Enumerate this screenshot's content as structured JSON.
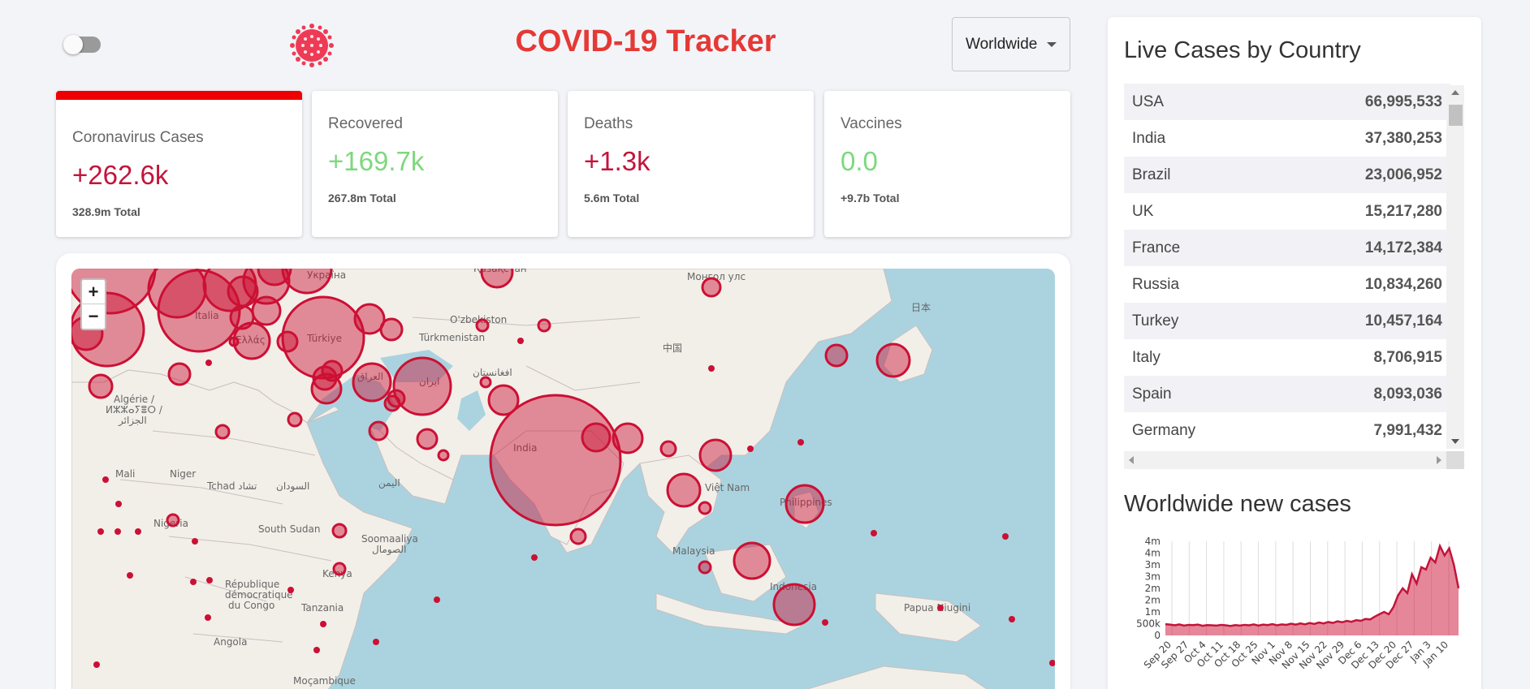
{
  "header": {
    "title": "COVID-19 Tracker",
    "country_select": "Worldwide",
    "theme_toggle_on": false
  },
  "stats": [
    {
      "label": "Coronavirus Cases",
      "value": "+262.6k",
      "total": "328.9m  Total",
      "color": "#c3143a",
      "active": true
    },
    {
      "label": "Recovered",
      "value": "+169.7k",
      "total": "267.8m  Total",
      "color": "#7dd87d",
      "active": false
    },
    {
      "label": "Deaths",
      "value": "+1.3k",
      "total": "5.6m  Total",
      "color": "#c3143a",
      "active": false
    },
    {
      "label": "Vaccines",
      "value": "0.0",
      "total": "+9.7b  Total",
      "color": "#7dd87d",
      "active": false
    }
  ],
  "map": {
    "zoom_in": "+",
    "zoom_out": "−",
    "labels": [
      "India",
      "Türkiye",
      "ایران",
      "Algérie / ⵍⵣⵣⴰⵢⴻⵔ / الجزائر",
      "Mali",
      "Niger",
      "Tchad تشاد",
      "السودان",
      "South Sudan",
      "Nigeria",
      "Soomaaliya الصومال",
      "Kenya",
      "Tanzania",
      "République démocratique du Congo",
      "Angola",
      "Moçambique",
      "O'zbekiston",
      "Türkmenistan",
      "افغانستان",
      "العراق",
      "中国",
      "日本",
      "Việt Nam",
      "Philippines",
      "Malaysia",
      "Indonesia",
      "Papua Niugini",
      "Ελλάς",
      "Italia",
      "Монгол улс",
      "Қазақстан",
      "Україна",
      "اليمن"
    ]
  },
  "live_cases": {
    "title": "Live Cases by Country",
    "rows": [
      {
        "country": "USA",
        "cases": "66,995,533"
      },
      {
        "country": "India",
        "cases": "37,380,253"
      },
      {
        "country": "Brazil",
        "cases": "23,006,952"
      },
      {
        "country": "UK",
        "cases": "15,217,280"
      },
      {
        "country": "France",
        "cases": "14,172,384"
      },
      {
        "country": "Russia",
        "cases": "10,834,260"
      },
      {
        "country": "Turkey",
        "cases": "10,457,164"
      },
      {
        "country": "Italy",
        "cases": "8,706,915"
      },
      {
        "country": "Spain",
        "cases": "8,093,036"
      },
      {
        "country": "Germany",
        "cases": "7,991,432"
      }
    ]
  },
  "new_cases": {
    "title": "Worldwide new cases"
  },
  "chart_data": {
    "type": "area",
    "title": "Worldwide new cases",
    "y_tick_labels": [
      "0",
      "500k",
      "1m",
      "2m",
      "2m",
      "3m",
      "3m",
      "4m",
      "4m"
    ],
    "ylim": [
      0,
      4000000
    ],
    "x_tick_labels": [
      "Sep 20",
      "Sep 27",
      "Oct 4",
      "Oct 11",
      "Oct 18",
      "Oct 25",
      "Nov 1",
      "Nov 8",
      "Nov 15",
      "Nov 22",
      "Nov 29",
      "Dec 6",
      "Dec 13",
      "Dec 20",
      "Dec 27",
      "Jan 3",
      "Jan 10"
    ],
    "series": [
      {
        "color": "#c3143a",
        "values": [
          480000,
          460000,
          430000,
          470000,
          420000,
          450000,
          440000,
          460000,
          410000,
          440000,
          430000,
          420000,
          450000,
          430000,
          400000,
          440000,
          420000,
          450000,
          430000,
          470000,
          420000,
          460000,
          440000,
          480000,
          430000,
          470000,
          450000,
          500000,
          460000,
          510000,
          470000,
          530000,
          490000,
          550000,
          510000,
          570000,
          530000,
          600000,
          560000,
          620000,
          580000,
          650000,
          620000,
          700000,
          680000,
          800000,
          900000,
          1000000,
          900000,
          1200000,
          1700000,
          2000000,
          1800000,
          2600000,
          2200000,
          2900000,
          2800000,
          3300000,
          3100000,
          3800000,
          3400000,
          3700000,
          3000000,
          2000000
        ]
      }
    ],
    "grid": "vertical",
    "legend": "none"
  }
}
